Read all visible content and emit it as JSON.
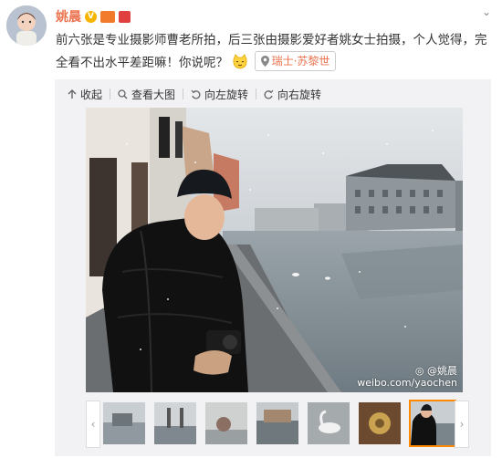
{
  "author": {
    "name": "姚晨",
    "verified": "V"
  },
  "post": {
    "text": "前六张是专业摄影师曹老所拍，后三张由摄影爱好者姚女士拍摄，个人觉得，完全看不出水平差距嘛！你说呢？",
    "location": "瑞士·苏黎世"
  },
  "toolbar": {
    "collapse": "收起",
    "view_large": "查看大图",
    "rotate_left": "向左旋转",
    "rotate_right": "向右旋转"
  },
  "photo": {
    "watermark_name": "@姚晨",
    "watermark_url": "weibo.com/yaochen"
  },
  "thumbnails": {
    "count": 7,
    "selected_index": 7
  },
  "colors": {
    "accent": "#eb7350",
    "selected_border": "#ff8a00"
  }
}
